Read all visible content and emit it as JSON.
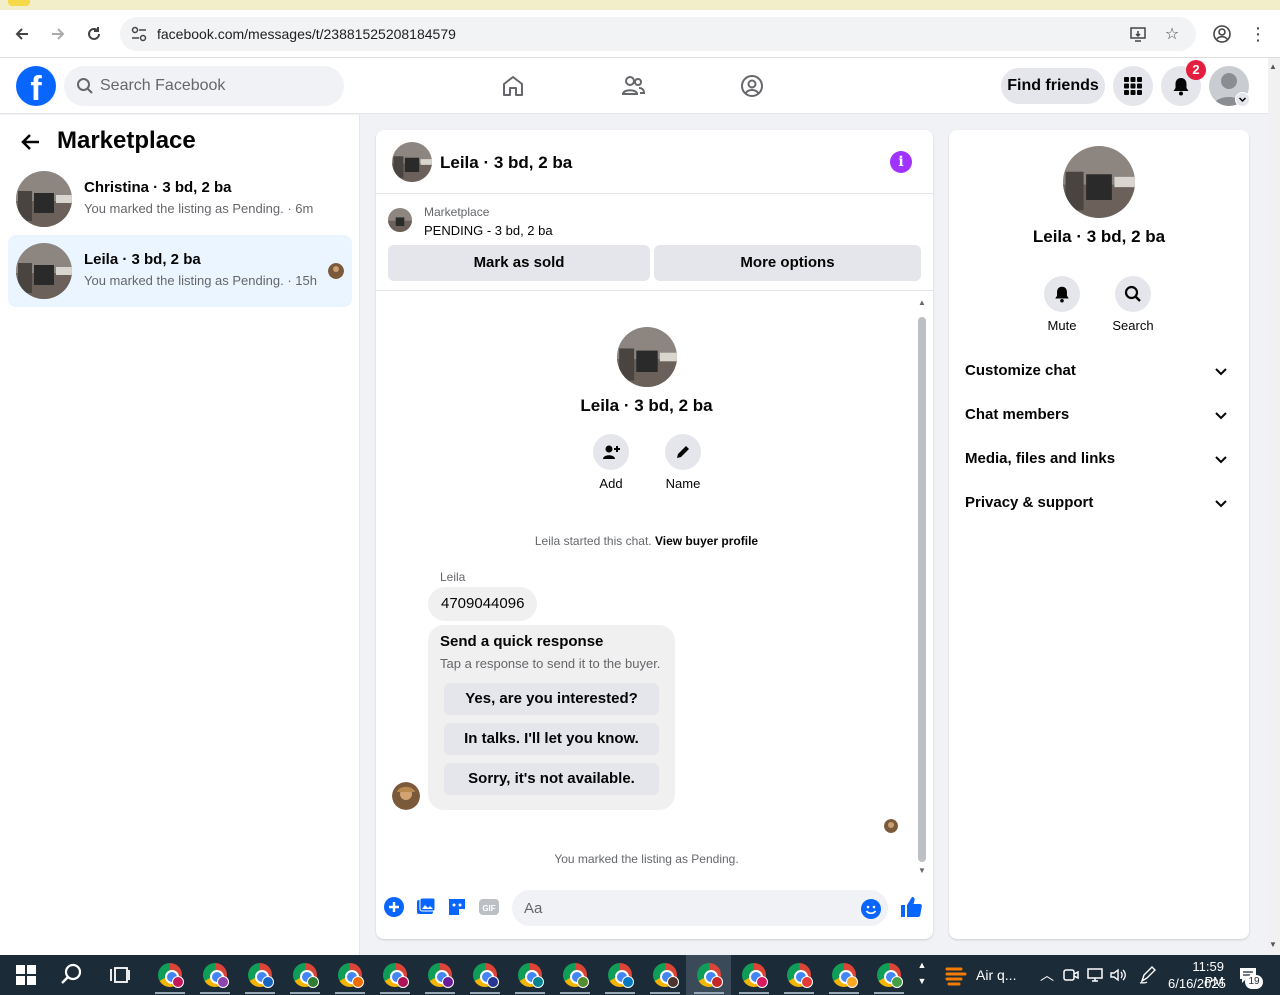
{
  "browser": {
    "url": "facebook.com/messages/t/23881525208184579"
  },
  "header": {
    "search_placeholder": "Search Facebook",
    "find_friends": "Find friends",
    "notification_count": "2"
  },
  "left": {
    "title": "Marketplace",
    "conversations": [
      {
        "name": "Christina · 3 bd, 2 ba",
        "sub": "You marked the listing as Pending. · 6m"
      },
      {
        "name": "Leila · 3 bd, 2 ba",
        "sub": "You marked the listing as Pending. · 15h"
      }
    ]
  },
  "chat": {
    "title": "Leila · 3 bd, 2 ba",
    "listing_source": "Marketplace",
    "listing_status": "PENDING - 3 bd, 2 ba",
    "mark_sold": "Mark as sold",
    "more_options": "More options",
    "profile_name": "Leila · 3 bd, 2 ba",
    "actions": [
      "Add",
      "Name"
    ],
    "started_text": "Leila started this chat.",
    "view_buyer": "View buyer profile",
    "sender": "Leila",
    "message": "4709044096",
    "qr_title": "Send a quick response",
    "qr_sub": "Tap a response to send it to the buyer.",
    "qr_options": [
      "Yes, are you interested?",
      "In talks. I'll let you know.",
      "Sorry, it's not available."
    ],
    "pending_note": "You marked the listing as Pending.",
    "composer_placeholder": "Aa"
  },
  "right": {
    "name": "Leila · 3 bd, 2 ba",
    "actions": [
      "Mute",
      "Search"
    ],
    "sections": [
      "Customize chat",
      "Chat members",
      "Media, files and links",
      "Privacy & support"
    ]
  },
  "taskbar": {
    "weather": "Air q...",
    "time": "11:59 PM",
    "date": "6/16/2025",
    "notif_count": "19"
  },
  "colors": {
    "brand": "#0866ff",
    "accent_purple": "#a033ff",
    "active_row": "#ebf5ff",
    "badge": "#e41e3f"
  }
}
